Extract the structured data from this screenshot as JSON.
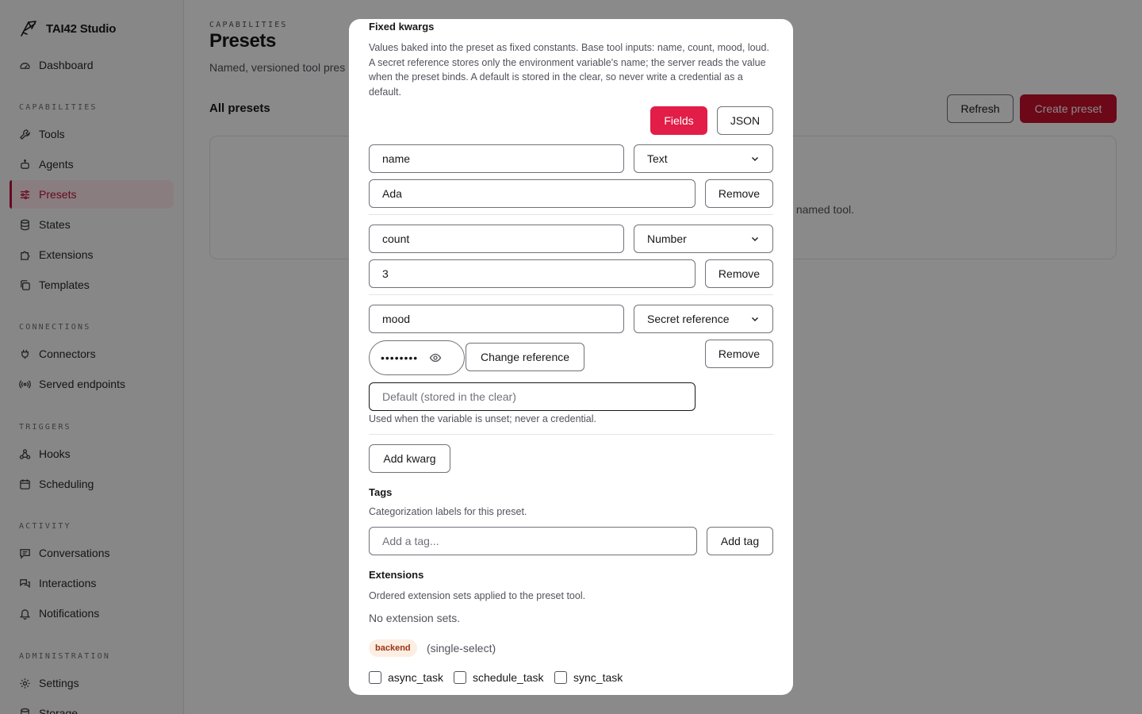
{
  "app": {
    "brand": "TAI42 Studio"
  },
  "sidebar": {
    "dashboard": "Dashboard",
    "sections": {
      "capabilities": "CAPABILITIES",
      "connections": "CONNECTIONS",
      "triggers": "TRIGGERS",
      "activity": "ACTIVITY",
      "administration": "ADMINISTRATION"
    },
    "items": {
      "tools": "Tools",
      "agents": "Agents",
      "presets": "Presets",
      "states": "States",
      "extensions": "Extensions",
      "templates": "Templates",
      "connectors": "Connectors",
      "served_endpoints": "Served endpoints",
      "hooks": "Hooks",
      "scheduling": "Scheduling",
      "conversations": "Conversations",
      "interactions": "Interactions",
      "notifications": "Notifications",
      "settings": "Settings",
      "storage": "Storage"
    }
  },
  "page": {
    "kicker": "CAPABILITIES",
    "title": "Presets",
    "subtitle": "Named, versioned tool pres",
    "list_title": "All presets",
    "refresh_label": "Refresh",
    "create_label": "Create preset",
    "empty_text": "named tool."
  },
  "modal": {
    "fixed_kwargs": {
      "title": "Fixed kwargs",
      "description": "Values baked into the preset as fixed constants. Base tool inputs: name, count, mood, loud. A secret reference stores only the environment variable's name; the server reads the value when the preset binds. A default is stored in the clear, so never write a credential as a default.",
      "mode_fields": "Fields",
      "mode_json": "JSON",
      "rows": [
        {
          "key": "name",
          "type": "Text",
          "value": "Ada",
          "remove": "Remove"
        },
        {
          "key": "count",
          "type": "Number",
          "value": "3",
          "remove": "Remove"
        },
        {
          "key": "mood",
          "type": "Secret reference",
          "secret_mask": "••••••••",
          "change_reference": "Change reference",
          "default_placeholder": "Default (stored in the clear)",
          "hint": "Used when the variable is unset; never a credential.",
          "remove": "Remove"
        }
      ],
      "add_kwarg": "Add kwarg"
    },
    "tags": {
      "title": "Tags",
      "description": "Categorization labels for this preset.",
      "placeholder": "Add a tag...",
      "add_label": "Add tag"
    },
    "extensions": {
      "title": "Extensions",
      "description": "Ordered extension sets applied to the preset tool.",
      "empty": "No extension sets.",
      "badge": "backend",
      "mode": "(single-select)",
      "options": [
        "async_task",
        "schedule_task",
        "sync_task"
      ]
    }
  }
}
